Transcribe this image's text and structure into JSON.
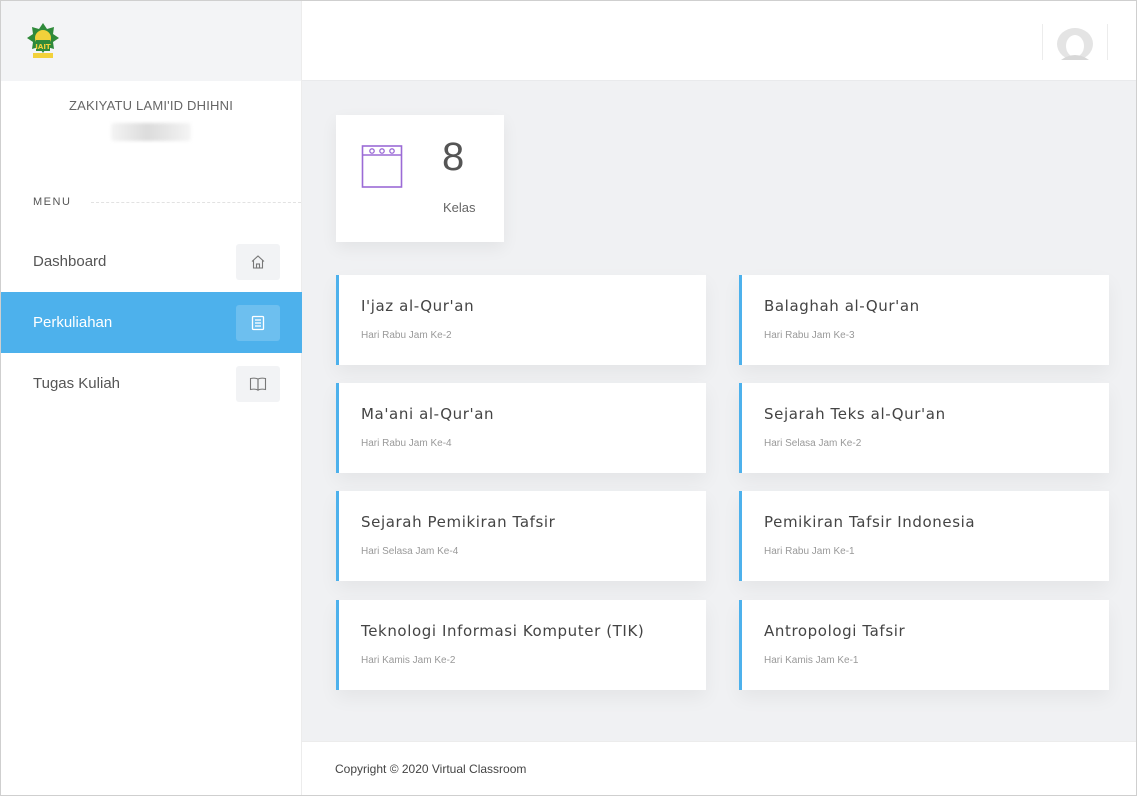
{
  "user": {
    "name": "ZAKIYATU LAMI'ID DHIHNI"
  },
  "menu": {
    "title": "MENU",
    "items": [
      {
        "label": "Dashboard",
        "icon": "home-icon",
        "active": false
      },
      {
        "label": "Perkuliahan",
        "icon": "document-icon",
        "active": true
      },
      {
        "label": "Tugas Kuliah",
        "icon": "book-icon",
        "active": false
      }
    ]
  },
  "stat": {
    "value": "8",
    "label": "Kelas",
    "icon": "calendar-icon"
  },
  "courses": [
    {
      "title": "I'jaz al-Qur'an",
      "schedule": "Hari Rabu Jam Ke-2"
    },
    {
      "title": "Balaghah al-Qur'an",
      "schedule": "Hari Rabu Jam Ke-3"
    },
    {
      "title": "Ma'ani al-Qur'an",
      "schedule": "Hari Rabu Jam Ke-4"
    },
    {
      "title": "Sejarah Teks al-Qur'an",
      "schedule": "Hari Selasa Jam Ke-2"
    },
    {
      "title": "Sejarah Pemikiran Tafsir",
      "schedule": "Hari Selasa Jam Ke-4"
    },
    {
      "title": "Pemikiran Tafsir Indonesia",
      "schedule": "Hari Rabu Jam Ke-1"
    },
    {
      "title": "Teknologi Informasi Komputer (TIK)",
      "schedule": "Hari Kamis Jam Ke-2"
    },
    {
      "title": "Antropologi Tafsir",
      "schedule": "Hari Kamis Jam Ke-1"
    }
  ],
  "footer": {
    "copyright": "Copyright © 2020 Virtual Classroom"
  },
  "colors": {
    "accent": "#4db1ec",
    "stat_icon": "#9b6bd6",
    "background": "#f0f1f3"
  }
}
